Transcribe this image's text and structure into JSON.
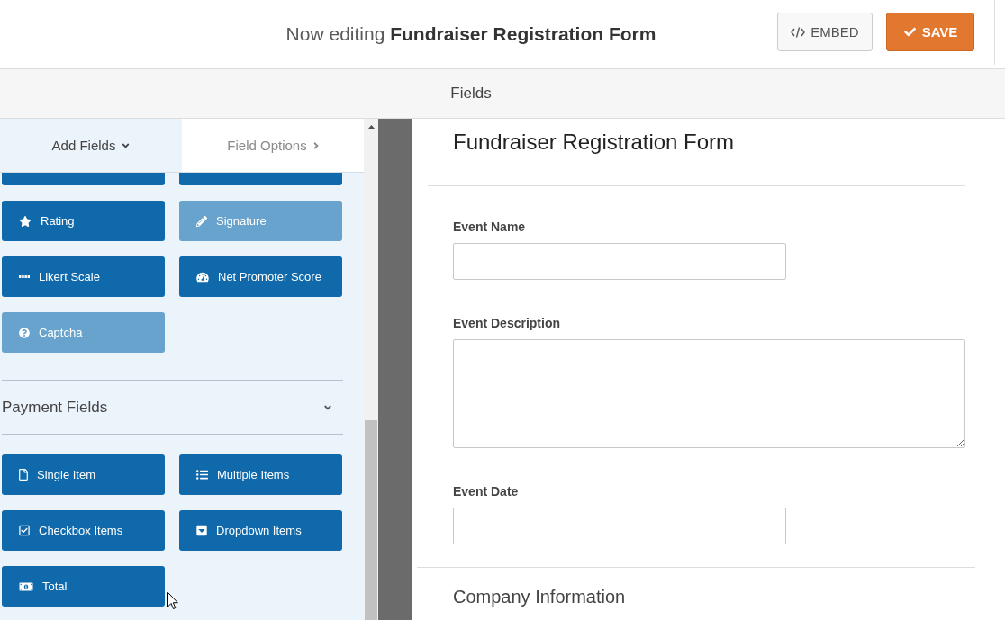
{
  "header": {
    "title": "Now editing **Fundraiser Registration Form**",
    "buttons": [
      {
        "kind": "embed",
        "label": "EMBED"
      },
      {
        "kind": "save",
        "label": "SAVE"
      }
    ]
  },
  "panel_bar": {
    "title": "Fields"
  },
  "sidebar": {
    "tabs": [
      {
        "label": "Add Fields",
        "selected": true
      },
      {
        "label": "Field Options",
        "selected": false
      }
    ],
    "groups": [
      {
        "items": [
          {
            "kind": "cut_off",
            "disabled": false
          },
          {
            "kind": "cut_off",
            "disabled": false
          },
          {
            "kind": "button",
            "label": "Rating",
            "disabled": false
          },
          {
            "kind": "button",
            "label": "Signature",
            "disabled": true
          },
          {
            "kind": "button",
            "label": "Likert Scale",
            "disabled": false
          },
          {
            "kind": "button",
            "label": "Net Promoter Score",
            "disabled": false
          },
          {
            "kind": "button",
            "label": "Captcha",
            "disabled": true
          }
        ]
      },
      {
        "title": "Payment Fields",
        "expanded": true,
        "items": [
          {
            "kind": "button",
            "label": "Single Item",
            "disabled": false
          },
          {
            "kind": "button",
            "label": "Multiple Items",
            "disabled": false
          },
          {
            "kind": "button",
            "label": "Checkbox Items",
            "disabled": false
          },
          {
            "kind": "button",
            "label": "Dropdown Items",
            "disabled": false
          },
          {
            "kind": "button",
            "label": "Total",
            "disabled": false
          }
        ]
      }
    ]
  },
  "form": {
    "title": "Fundraiser Registration Form",
    "fields": [
      {
        "kind": "text",
        "label": "Event Name"
      },
      {
        "kind": "textarea",
        "label": "Event Description"
      },
      {
        "kind": "text",
        "label": "Event Date"
      },
      {
        "kind": "section",
        "label": "Company Information"
      }
    ]
  }
}
